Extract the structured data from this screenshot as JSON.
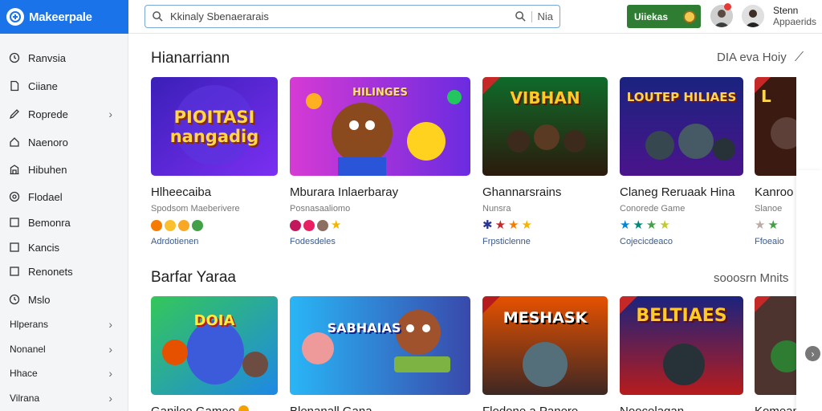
{
  "app": {
    "logo_text": "Makeerpale"
  },
  "search": {
    "value": "Kkinaly Sbenaerarais",
    "suffix": "Nia"
  },
  "header": {
    "cta_label": "Uiiekas",
    "user_name": "Stenn",
    "user_sub": "Appaerids"
  },
  "sidebar": {
    "items": [
      {
        "label": "Ranvsia",
        "icon": "clock-icon"
      },
      {
        "label": "Ciiane",
        "icon": "document-icon"
      },
      {
        "label": "Roprede",
        "icon": "edit-icon",
        "chevron": "›"
      },
      {
        "label": "Naenoro",
        "icon": "home-icon"
      },
      {
        "label": "Hibuhen",
        "icon": "building-icon"
      },
      {
        "label": "Flodael",
        "icon": "settings-icon"
      },
      {
        "label": "Bemonra",
        "icon": "square-icon"
      },
      {
        "label": "Kancis",
        "icon": "square-icon"
      },
      {
        "label": "Renonets",
        "icon": "square-icon"
      },
      {
        "label": "Mslo",
        "icon": "clock-icon"
      },
      {
        "label": "Hlperans",
        "chevron": "›"
      },
      {
        "label": "Nonanel",
        "chevron": "›"
      },
      {
        "label": "Hhace",
        "chevron": "›"
      },
      {
        "label": "Vilrana",
        "chevron": "›"
      }
    ]
  },
  "sections": [
    {
      "title": "Hianarriann",
      "link": "DIA eva Hoiy",
      "cards": [
        {
          "title": "Hlheecaiba",
          "sub": "Spodsom Maeberivere",
          "foot": "Adrdotienen",
          "thumb_text": "PIOITASI nangadig"
        },
        {
          "title": "Mburara Inlaerbaray",
          "sub": "Posnasaaliomo",
          "foot": "Fodesdeles",
          "thumb_text": "HILINGES"
        },
        {
          "title": "Ghannarsrains",
          "sub": "Nunsra",
          "foot": "Frpsticlenne",
          "thumb_text": "VIBHAN"
        },
        {
          "title": "Claneg Reruaak Hina",
          "sub": "Conorede Game",
          "foot": "Cojecicdeaco",
          "thumb_text": "LOUTEP HILIAES"
        },
        {
          "title": "Kanroo",
          "sub": "Slanoe",
          "foot": "Ffoeaio",
          "thumb_text": "L"
        }
      ]
    },
    {
      "title": "Barfar Yaraa",
      "link": "sooosrn Mnits",
      "cards": [
        {
          "title": "Ganileo Gameo",
          "thumb_text": "DOIA"
        },
        {
          "title": "Blenanall Gana",
          "thumb_text": "SABHAIAS"
        },
        {
          "title": "Flodone a Panere",
          "thumb_text": "MESHASK"
        },
        {
          "title": "Noocelagan",
          "thumb_text": "BELTIAES"
        },
        {
          "title": "Komean"
        }
      ]
    }
  ],
  "colors": {
    "brand": "#1a73e8",
    "cta": "#2e7d32",
    "sidebar_bg": "#f3f5f7"
  }
}
